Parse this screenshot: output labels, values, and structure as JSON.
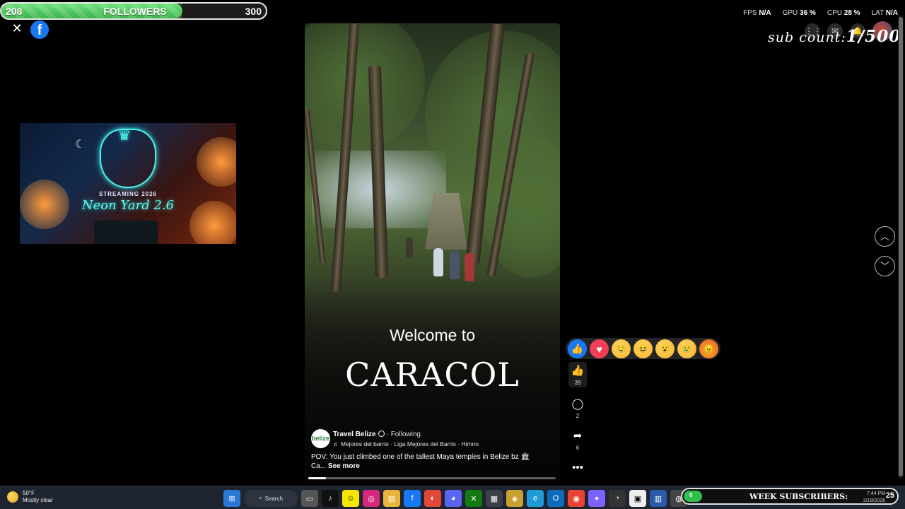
{
  "overlay": {
    "followers": {
      "min": "208",
      "label": "FOLLOWERS",
      "max": "300",
      "progress_fraction": 0.685
    },
    "perf": [
      {
        "label": "FPS",
        "value": "N/A"
      },
      {
        "label": "GPU",
        "value": "36 %"
      },
      {
        "label": "CPU",
        "value": "28 %"
      },
      {
        "label": "LAT",
        "value": "N/A"
      }
    ],
    "sub_count": {
      "label": "sub count:",
      "value": "1/500"
    }
  },
  "header": {
    "close_icon": "close-icon",
    "brand_icon": "facebook-logo",
    "brand_glyph": "f",
    "right_icons": [
      "apps-grid-icon",
      "messenger-icon",
      "notifications-icon",
      "profile-avatar"
    ]
  },
  "stream_banner": {
    "subtitle": "STREAMING 2026",
    "title": "Neon Yard 2.6"
  },
  "reel": {
    "overlay_line1": "Welcome to",
    "overlay_line2": "CARACOL",
    "page_name": "Travel Belize",
    "page_logo_text": "belize",
    "follow_status": "· Following",
    "song": "♬ Mejores del barrio · Liga Mejores del Barrio · Himno",
    "caption": "POV: You just climbed one of the tallest Maya temples in Belize",
    "caption_flag": "bz 🏛",
    "caption_trunc": "Ca...",
    "see_more": "See more",
    "progress_fraction": 0.07
  },
  "reactions": [
    {
      "name": "like",
      "glyph": "👍"
    },
    {
      "name": "love",
      "glyph": "♥"
    },
    {
      "name": "care",
      "glyph": "🤤"
    },
    {
      "name": "haha",
      "glyph": "😆"
    },
    {
      "name": "wow",
      "glyph": "😮"
    },
    {
      "name": "sad",
      "glyph": "😢"
    },
    {
      "name": "angry",
      "glyph": "😠"
    }
  ],
  "actions": {
    "like_count": "39",
    "comment_count": "2",
    "share_count": "6"
  },
  "nav": {
    "up_icon": "chevron-up-icon",
    "down_icon": "chevron-down-icon"
  },
  "taskbar": {
    "weather_temp": "50°F",
    "weather_desc": "Mostly clear",
    "search_label": "Search",
    "week_subscribers": {
      "current": "0",
      "label": "WEEK SUBSCRIBERS:",
      "max": "25"
    },
    "time": "7:44 PM",
    "date": "2/18/2026"
  }
}
